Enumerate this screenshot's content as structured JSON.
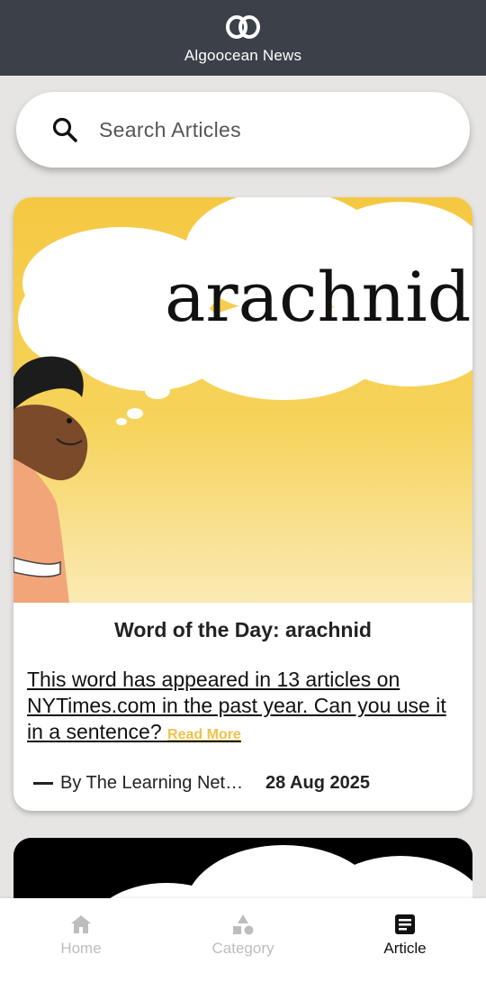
{
  "app": {
    "title": "Algoocean News"
  },
  "search": {
    "placeholder": "Search Articles",
    "value": ""
  },
  "articles": [
    {
      "image_word": "arachnid",
      "title": "Word of the Day: arachnid",
      "summary": "This word has appeared in 13 articles on NYTimes.com in the past year. Can you use it in a sentence?",
      "read_more": "Read More",
      "author": "By The Learning Network",
      "date": "28 Aug 2025"
    }
  ],
  "bottom_nav": {
    "items": [
      {
        "label": "Home",
        "icon": "home-icon",
        "active": false
      },
      {
        "label": "Category",
        "icon": "category-icon",
        "active": false
      },
      {
        "label": "Article",
        "icon": "article-icon",
        "active": true
      }
    ]
  },
  "colors": {
    "app_bar": "#3c4048",
    "accent_read_more": "#f0c24a",
    "image_yellow": "#f5cd48"
  }
}
